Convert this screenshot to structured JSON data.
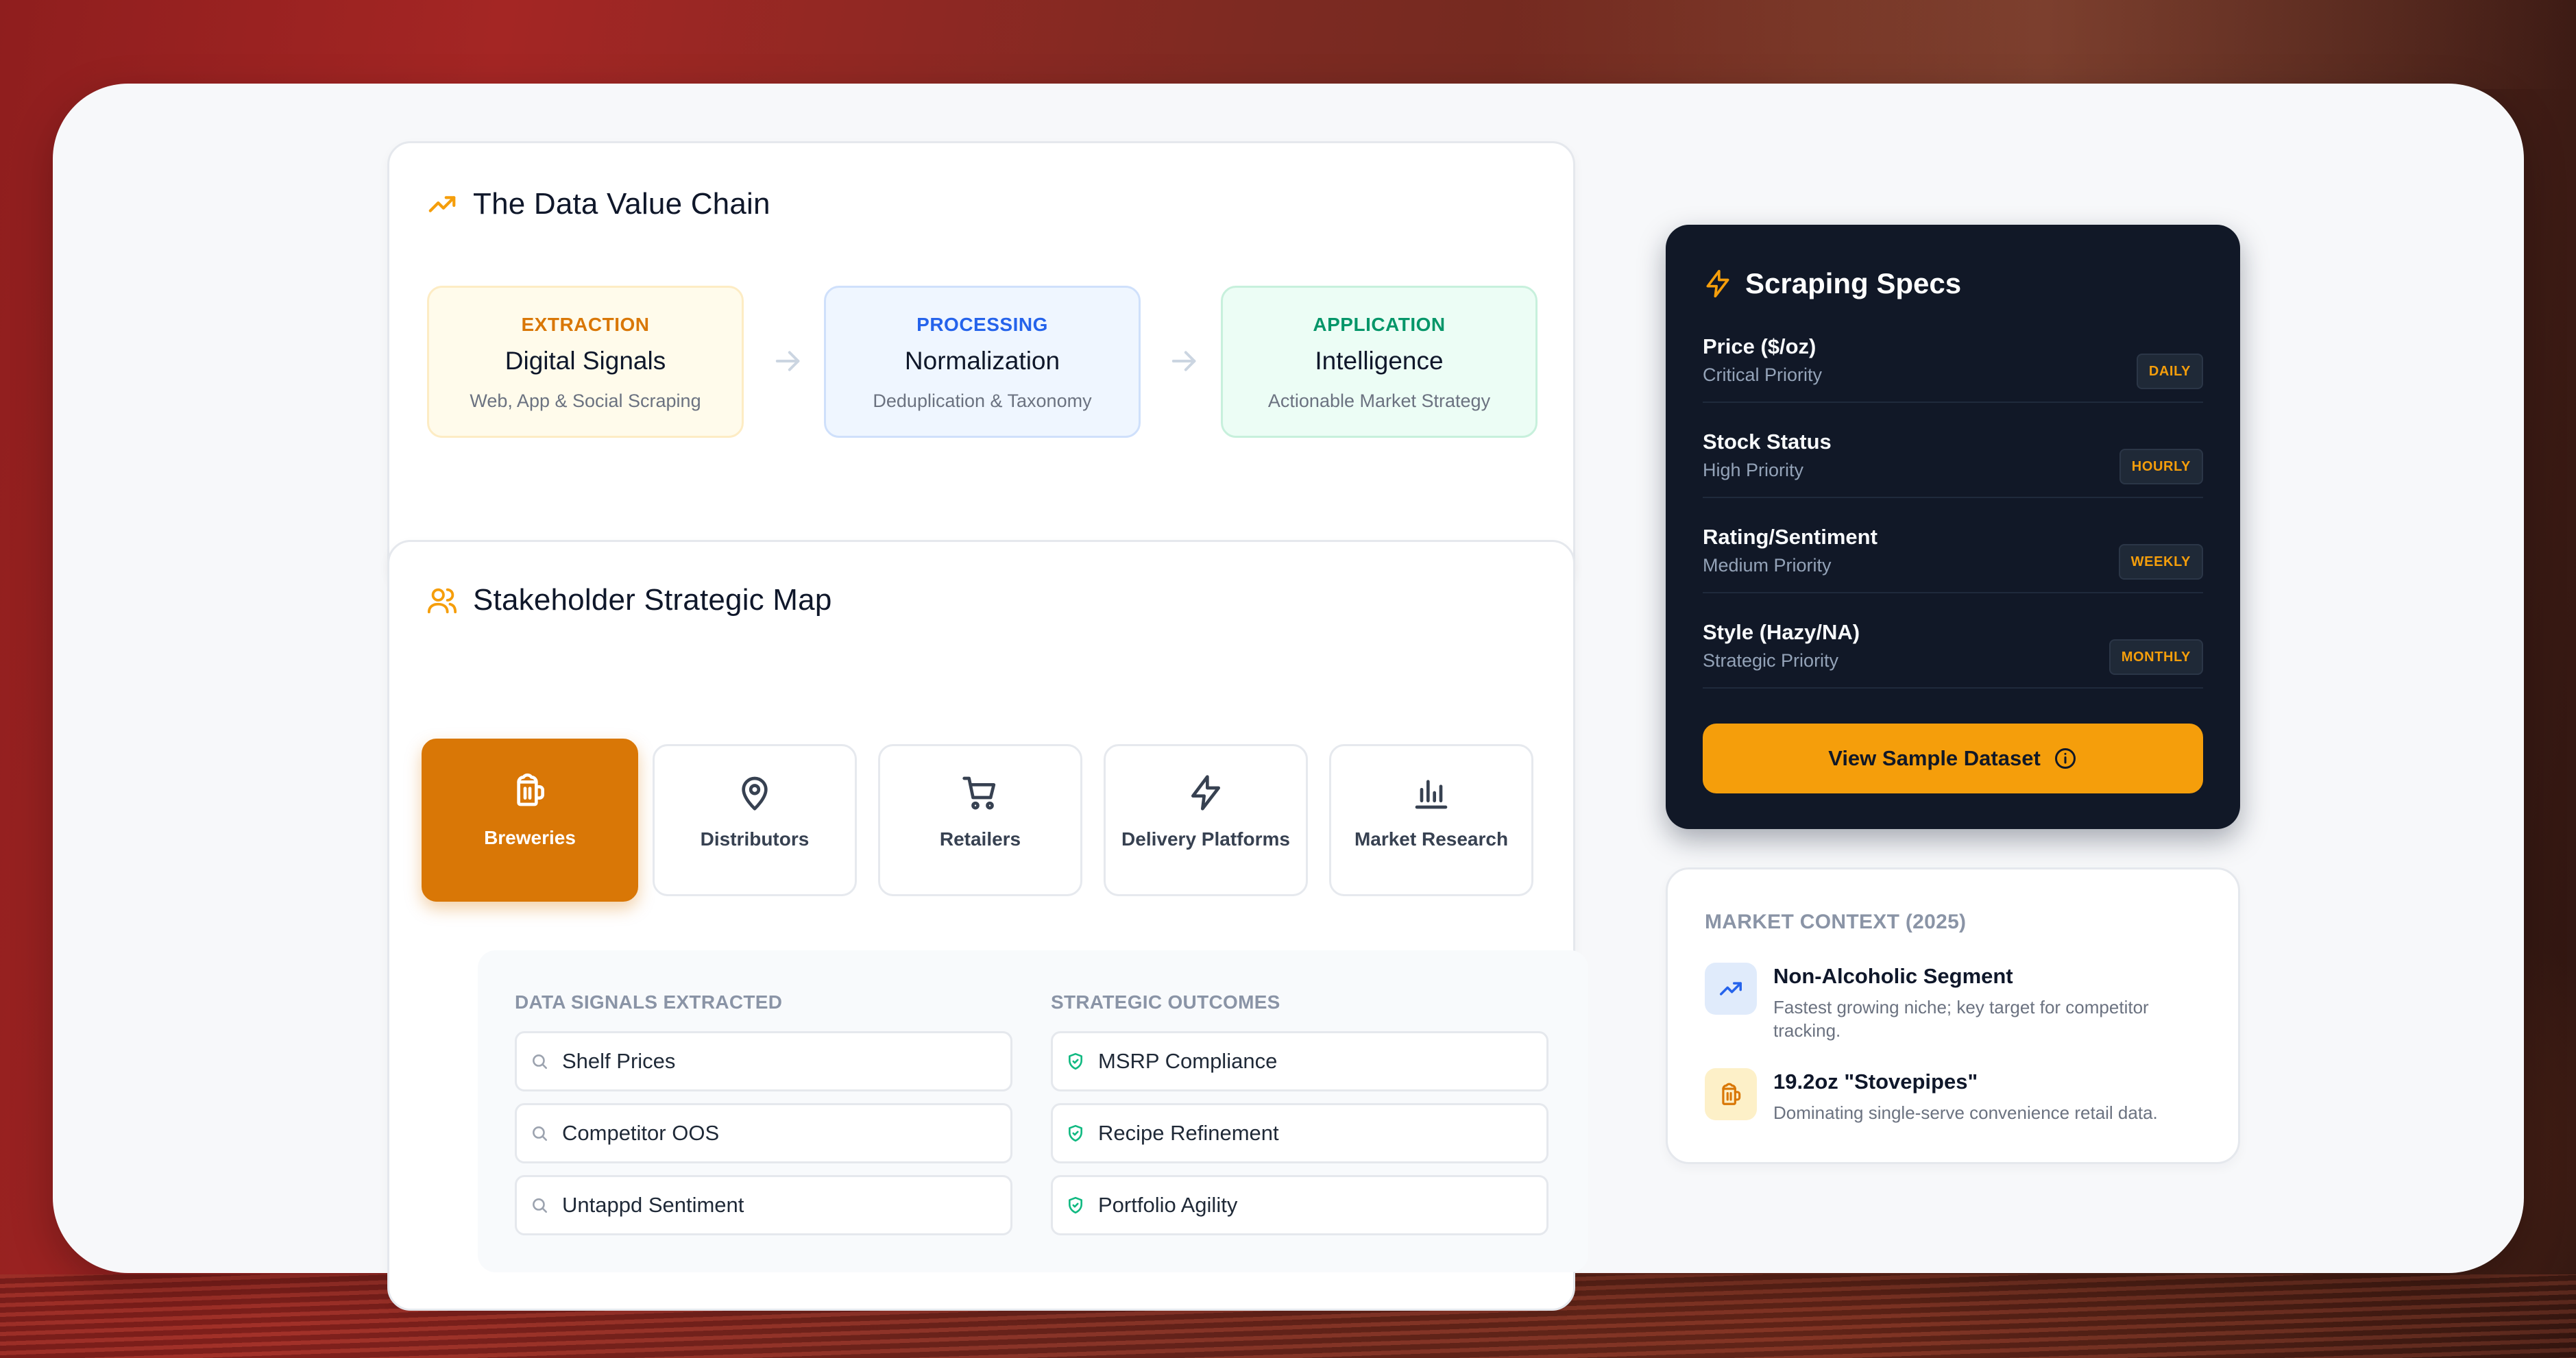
{
  "value_chain": {
    "title": "The Data Value Chain",
    "steps": [
      {
        "key": "EXTRACTION",
        "title": "Digital Signals",
        "subtitle": "Web, App & Social Scraping",
        "accent": "#d97706",
        "bg": "#fffbeb",
        "border": "#fdecc4"
      },
      {
        "key": "PROCESSING",
        "title": "Normalization",
        "subtitle": "Deduplication & Taxonomy",
        "accent": "#2563eb",
        "bg": "#eff6ff",
        "border": "#cfe0fb"
      },
      {
        "key": "APPLICATION",
        "title": "Intelligence",
        "subtitle": "Actionable Market Strategy",
        "accent": "#059669",
        "bg": "#ecfdf5",
        "border": "#c7f0dc"
      }
    ]
  },
  "stakeholders": {
    "title": "Stakeholder Strategic Map",
    "tabs": [
      {
        "label": "Breweries",
        "icon": "beer-mug-icon",
        "active": true
      },
      {
        "label": "Distributors",
        "icon": "map-pin-icon",
        "active": false
      },
      {
        "label": "Retailers",
        "icon": "shopping-cart-icon",
        "active": false
      },
      {
        "label": "Delivery Platforms",
        "icon": "lightning-icon",
        "active": false
      },
      {
        "label": "Market Research",
        "icon": "bar-chart-icon",
        "active": false
      }
    ],
    "signals_heading": "DATA SIGNALS EXTRACTED",
    "outcomes_heading": "STRATEGIC OUTCOMES",
    "signals": [
      "Shelf Prices",
      "Competitor OOS",
      "Untappd Sentiment"
    ],
    "outcomes": [
      "MSRP Compliance",
      "Recipe Refinement",
      "Portfolio Agility"
    ]
  },
  "specs": {
    "title": "Scraping Specs",
    "rows": [
      {
        "name": "Price ($/oz)",
        "priority": "Critical Priority",
        "frequency": "DAILY"
      },
      {
        "name": "Stock Status",
        "priority": "High Priority",
        "frequency": "HOURLY"
      },
      {
        "name": "Rating/Sentiment",
        "priority": "Medium Priority",
        "frequency": "WEEKLY"
      },
      {
        "name": "Style (Hazy/NA)",
        "priority": "Strategic Priority",
        "frequency": "MONTHLY"
      }
    ],
    "cta_label": "View Sample Dataset"
  },
  "market_context": {
    "heading": "MARKET CONTEXT (2025)",
    "items": [
      {
        "title": "Non-Alcoholic Segment",
        "desc": "Fastest growing niche; key target for competitor tracking.",
        "icon": "trending-up-icon"
      },
      {
        "title": "19.2oz \"Stovepipes\"",
        "desc": "Dominating single-serve convenience retail data.",
        "icon": "beer-mug-icon"
      }
    ]
  },
  "colors": {
    "accent": "#d97706",
    "amber": "#f59e0b",
    "dark": "#111827"
  }
}
